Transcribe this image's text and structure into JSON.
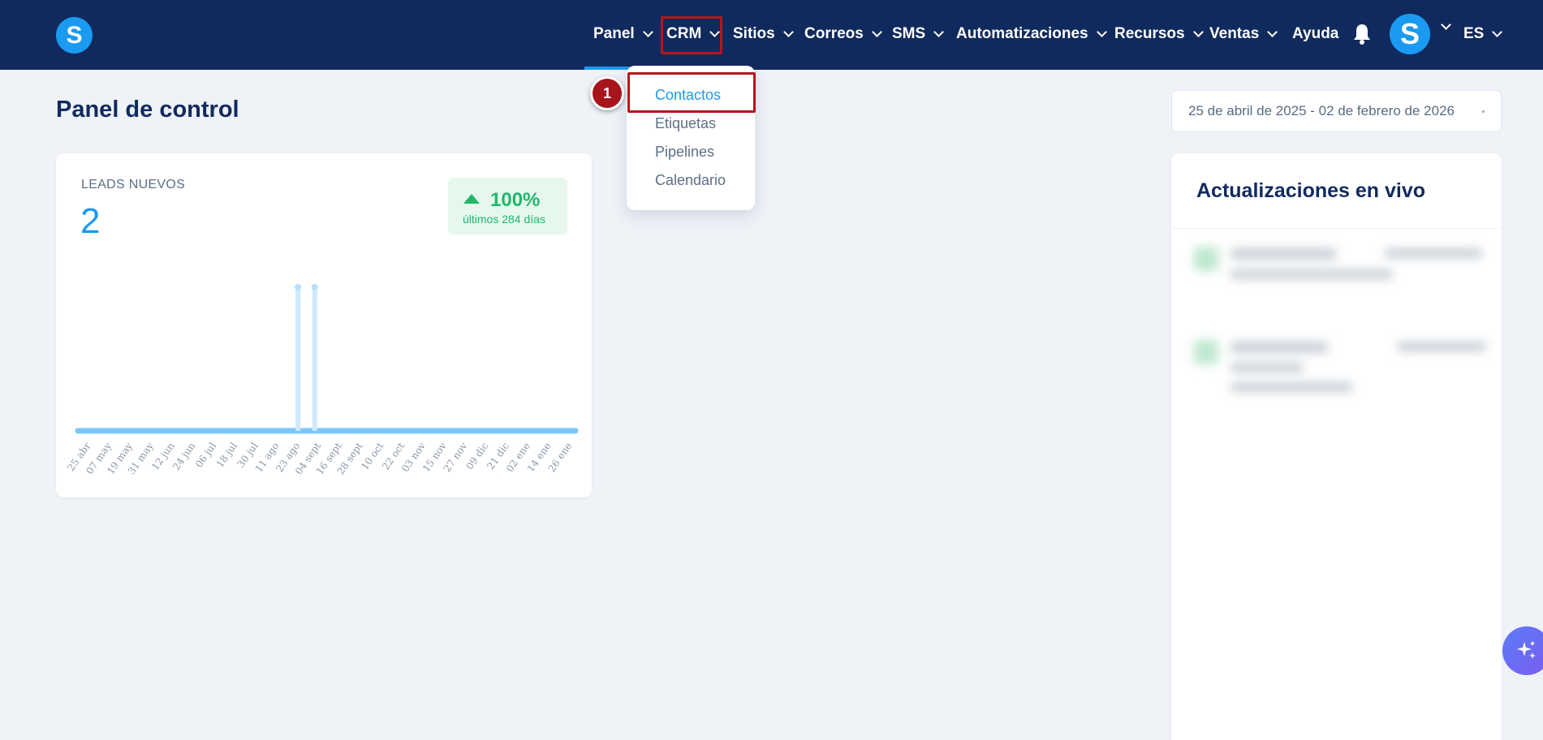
{
  "brand": {
    "logo_letter": "S"
  },
  "nav": {
    "items": [
      {
        "label": "Panel",
        "has_dropdown": true
      },
      {
        "label": "CRM",
        "has_dropdown": true
      },
      {
        "label": "Sitios",
        "has_dropdown": true
      },
      {
        "label": "Correos",
        "has_dropdown": true
      },
      {
        "label": "SMS",
        "has_dropdown": true
      },
      {
        "label": "Automatizaciones",
        "has_dropdown": true
      },
      {
        "label": "Recursos",
        "has_dropdown": true
      },
      {
        "label": "Ventas",
        "has_dropdown": true
      },
      {
        "label": "Ayuda",
        "has_dropdown": false
      }
    ],
    "avatar_letter": "S",
    "language": "ES"
  },
  "crm_menu": {
    "items": [
      {
        "label": "Contactos",
        "active": true
      },
      {
        "label": "Etiquetas",
        "active": false
      },
      {
        "label": "Pipelines",
        "active": false
      },
      {
        "label": "Calendario",
        "active": false
      }
    ],
    "step_marker": "1"
  },
  "page": {
    "title": "Panel de control",
    "date_range": "25 de abril de 2025 - 02 de febrero de 2026"
  },
  "leads_card": {
    "label": "LEADS NUEVOS",
    "value": "2",
    "change_pct": "100%",
    "change_period": "últimos 284 días"
  },
  "chart_data": {
    "type": "line",
    "categories": [
      "25 abr",
      "07 may",
      "19 may",
      "31 may",
      "12 jun",
      "24 jun",
      "06 jul",
      "18 jul",
      "30 jul",
      "11 ago",
      "23 ago",
      "04 sept",
      "16 sept",
      "28 sept",
      "10 oct",
      "22 oct",
      "03 nov",
      "15 nov",
      "27 nov",
      "09 dic",
      "21 dic",
      "02 ene",
      "14 ene",
      "26 ene"
    ],
    "spikes": [
      {
        "position": 10.05,
        "value": 1
      },
      {
        "position": 10.85,
        "value": 1
      }
    ],
    "baseline": 0,
    "ylim": [
      0,
      1
    ]
  },
  "live_updates": {
    "title": "Actualizaciones en vivo"
  },
  "colors": {
    "nav_bg": "#112a5e",
    "accent": "#1a9af0",
    "highlight": "#b3161e",
    "success": "#20b86a",
    "page_bg": "#eff3f8"
  }
}
